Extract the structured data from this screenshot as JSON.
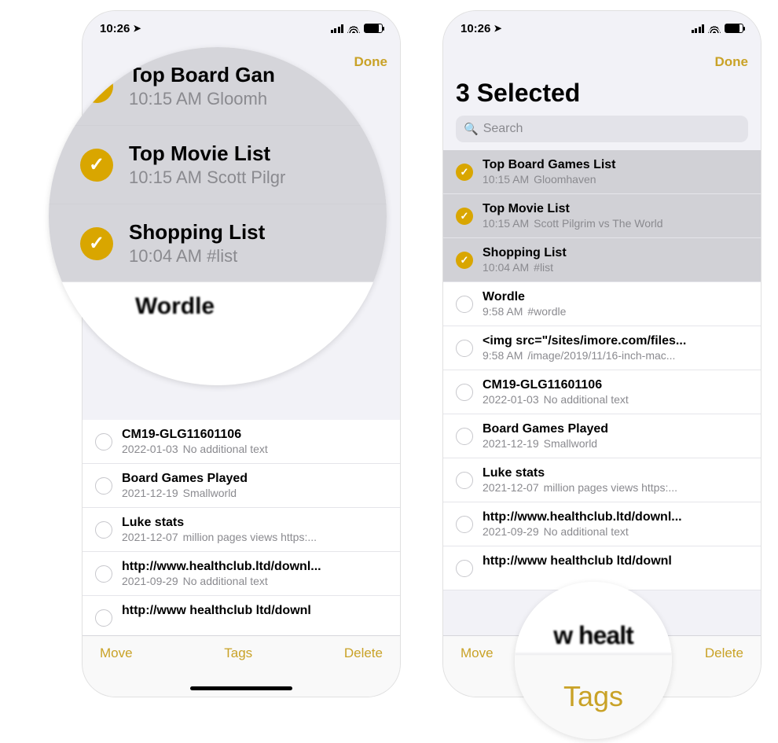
{
  "status": {
    "time": "10:26",
    "loc_glyph": "➤"
  },
  "nav": {
    "done": "Done"
  },
  "right": {
    "title": "3 Selected",
    "search_placeholder": "Search"
  },
  "toolbar": {
    "move": "Move",
    "tags": "Tags",
    "delete": "Delete"
  },
  "notes": [
    {
      "title": "Top Board Games List",
      "time": "10:15 AM",
      "preview": "Gloomhaven",
      "selected": true
    },
    {
      "title": "Top Movie List",
      "time": "10:15 AM",
      "preview": "Scott Pilgrim vs The World",
      "selected": true
    },
    {
      "title": "Shopping List",
      "time": "10:04 AM",
      "preview": "#list",
      "selected": true
    },
    {
      "title": "Wordle",
      "time": "9:58 AM",
      "preview": "#wordle",
      "selected": false
    },
    {
      "title": "<img src=\"/sites/imore.com/files...",
      "time": "9:58 AM",
      "preview": "/image/2019/11/16-inch-mac...",
      "selected": false
    },
    {
      "title": "CM19-GLG11601106",
      "time": "2022-01-03",
      "preview": "No additional text",
      "selected": false
    },
    {
      "title": "Board Games Played",
      "time": "2021-12-19",
      "preview": "Smallworld",
      "selected": false
    },
    {
      "title": "Luke stats",
      "time": "2021-12-07",
      "preview": "million pages views https:...",
      "selected": false
    },
    {
      "title": "http://www.healthclub.ltd/downl...",
      "time": "2021-09-29",
      "preview": "No additional text",
      "selected": false
    },
    {
      "title": "http://www healthclub ltd/downl",
      "time": "",
      "preview": "",
      "selected": false
    }
  ],
  "mag1": {
    "r0": {
      "title": "Top Board Gan",
      "sub": "10:15 AM  Gloomh"
    },
    "r1": {
      "title": "Top Movie List",
      "sub": "10:15 AM  Scott Pilgr"
    },
    "r2": {
      "title": "Shopping List",
      "sub": "10:04 AM  #list"
    },
    "peek": "Wordle"
  },
  "mag2": {
    "peek": "w healt",
    "label": "Tags"
  },
  "left_visible_start": 5
}
